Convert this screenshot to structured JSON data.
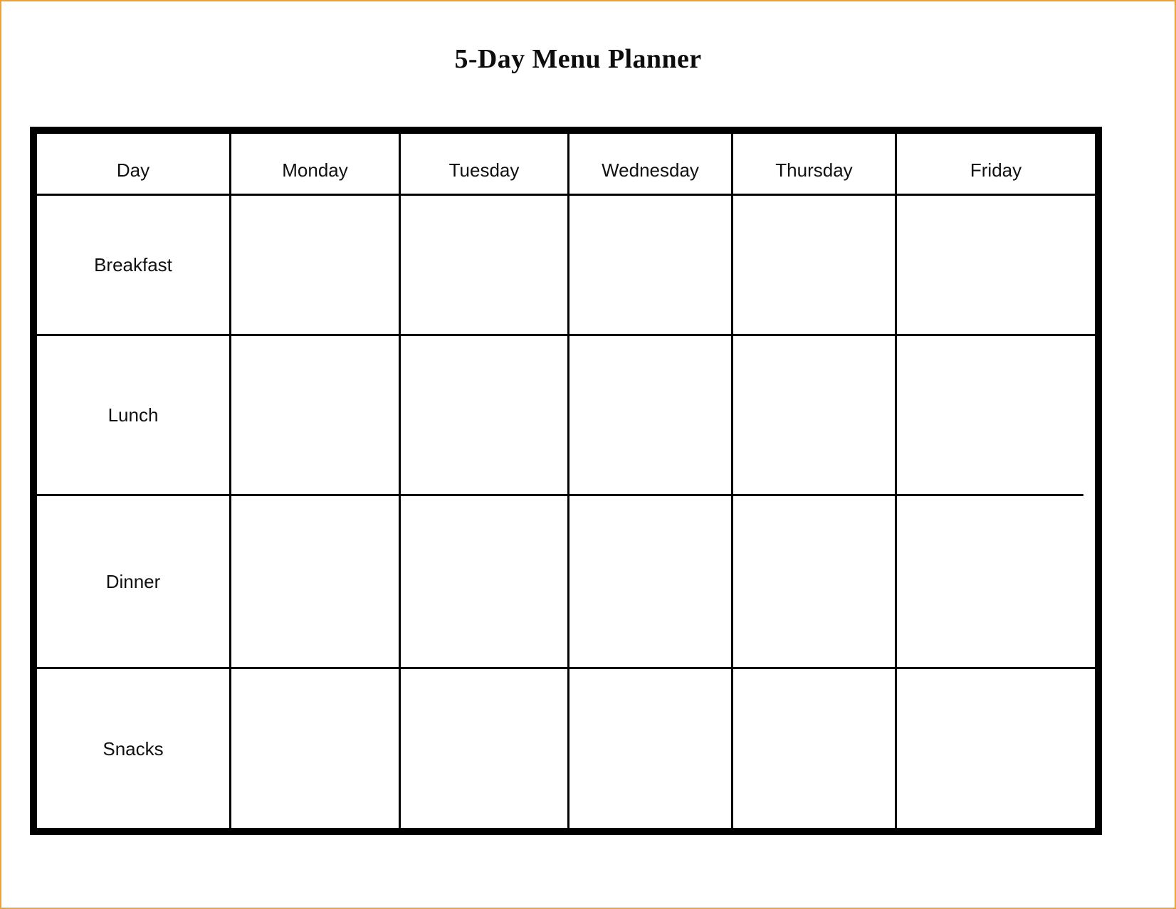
{
  "page": {
    "border_color": "#e8a33d",
    "background": "#ffffff"
  },
  "title": "5-Day Menu Planner",
  "table": {
    "border_color": "#000000",
    "grid_color": "#000000",
    "columns": [
      {
        "key": "day",
        "label": "Day"
      },
      {
        "key": "monday",
        "label": "Monday"
      },
      {
        "key": "tuesday",
        "label": "Tuesday"
      },
      {
        "key": "wednesday",
        "label": "Wednesday"
      },
      {
        "key": "thursday",
        "label": "Thursday"
      },
      {
        "key": "friday",
        "label": "Friday"
      }
    ],
    "rows": [
      {
        "key": "breakfast",
        "label": "Breakfast",
        "cells": [
          "",
          "",
          "",
          "",
          ""
        ]
      },
      {
        "key": "lunch",
        "label": "Lunch",
        "cells": [
          "",
          "",
          "",
          "",
          ""
        ]
      },
      {
        "key": "dinner",
        "label": "Dinner",
        "cells": [
          "",
          "",
          "",
          "",
          ""
        ]
      },
      {
        "key": "snacks",
        "label": "Snacks",
        "cells": [
          "",
          "",
          "",
          "",
          ""
        ]
      }
    ]
  }
}
